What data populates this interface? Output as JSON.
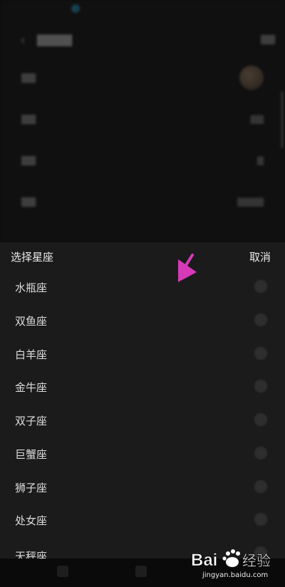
{
  "sheet": {
    "title": "选择星座",
    "cancel_label": "取消",
    "options": [
      {
        "label": "水瓶座"
      },
      {
        "label": "双鱼座"
      },
      {
        "label": "白羊座"
      },
      {
        "label": "金牛座"
      },
      {
        "label": "双子座"
      },
      {
        "label": "巨蟹座"
      },
      {
        "label": "狮子座"
      },
      {
        "label": "处女座"
      },
      {
        "label": "天秤座"
      }
    ]
  },
  "annotation": {
    "icon": "pink-arrow-icon",
    "color": "#d63ab8"
  },
  "watermark": {
    "logo_text": "Bai 经验",
    "url": "jingyan.baidu.com"
  },
  "colors": {
    "sheet_bg": "#1b1b1b",
    "page_bg": "#0c0c0c",
    "text": "#ececec"
  }
}
